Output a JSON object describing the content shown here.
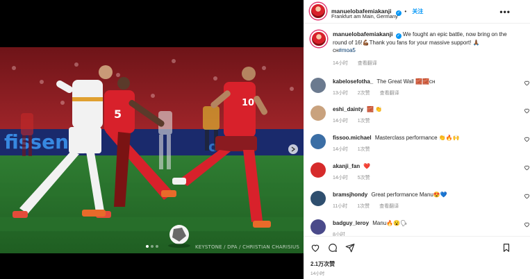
{
  "post": {
    "author": "manuelobafemiakanji",
    "follow_label": "关注",
    "location": "Frankfurt am Main, Germany",
    "more_label": "•••",
    "photo_credit": "KEYSTONE / DPA / CHRISTIAN CHARISIUS",
    "carousel": {
      "count": 3,
      "active": 0
    },
    "caption": {
      "text": "We fought an epic battle, now bring on the round of 16!💪🏾Thank you fans for your massive support! 🙏🏾",
      "hashtag_prefix": "cн",
      "hashtag": "#moa5",
      "time": "14小时",
      "translation_label": "查看翻译"
    },
    "likes": "2.1万次赞",
    "time": "14小时"
  },
  "comments": [
    {
      "user": "kabelosefotha_",
      "text": "The Great Wall 🧱🧱cн",
      "time": "13小时",
      "likes": "2次赞",
      "extra": "查看翻译",
      "avatar_color": "#6b7a8f"
    },
    {
      "user": "eshi_dainty",
      "text": "🧱 👏",
      "time": "14小时",
      "likes": "1次赞",
      "extra": "",
      "avatar_color": "#c9a27e"
    },
    {
      "user": "fissoo.michael",
      "text": "Masterclass performance 👏🔥🙌",
      "time": "14小时",
      "likes": "1次赞",
      "extra": "",
      "avatar_color": "#3b6ea5"
    },
    {
      "user": "akanji_fan",
      "text": "❤️",
      "time": "14小时",
      "likes": "5次赞",
      "extra": "",
      "avatar_color": "#d62b2b"
    },
    {
      "user": "bramsjhondy",
      "text": "Great performance Manu😍💙",
      "time": "11小时",
      "likes": "1次赞",
      "extra": "查看翻译",
      "avatar_color": "#2f4f6f"
    },
    {
      "user": "badguy_leroy",
      "text": "Manu🔥😮🗣",
      "time": "8小时",
      "likes": "",
      "extra": "",
      "avatar_color": "#4a4a8a"
    }
  ],
  "icons": {
    "like": "heart-icon",
    "comment": "comment-icon",
    "share": "share-icon",
    "save": "bookmark-icon",
    "verified": "verified-badge-icon",
    "next": "chevron-right-icon"
  },
  "colors": {
    "link": "#0095f6",
    "muted": "#8e8e8e",
    "switzerland_red": "#d8212b"
  }
}
